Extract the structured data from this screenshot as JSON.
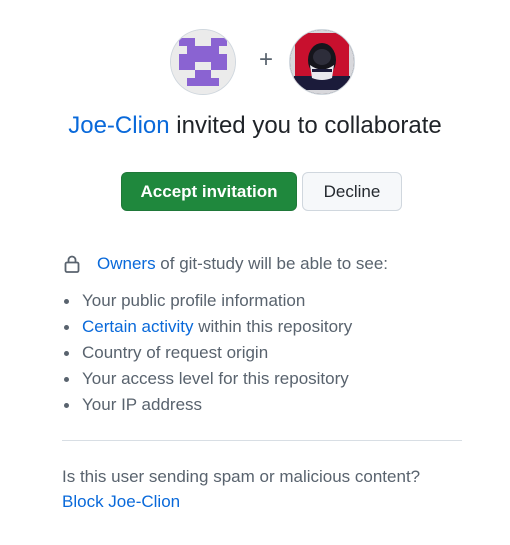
{
  "inviter": {
    "name": "Joe-Clion"
  },
  "plus_sign": "+",
  "headline": {
    "suffix": " invited you to collaborate"
  },
  "actions": {
    "accept_label": "Accept invitation",
    "decline_label": "Decline"
  },
  "privacy_notice": {
    "owners_link": "Owners",
    "rest": " of git-study will be able to see:",
    "items": [
      {
        "text": "Your public profile information"
      },
      {
        "link": "Certain activity",
        "text": " within this repository"
      },
      {
        "text": "Country of request origin"
      },
      {
        "text": "Your access level for this repository"
      },
      {
        "text": "Your IP address"
      }
    ]
  },
  "spam": {
    "question": "Is this user sending spam or malicious content?",
    "block_link": "Block Joe-Clion"
  },
  "colors": {
    "accept_green": "#1f883d",
    "link_blue": "#0969da",
    "muted_text": "#59636e",
    "identicon_purple": "#8a63d2"
  }
}
